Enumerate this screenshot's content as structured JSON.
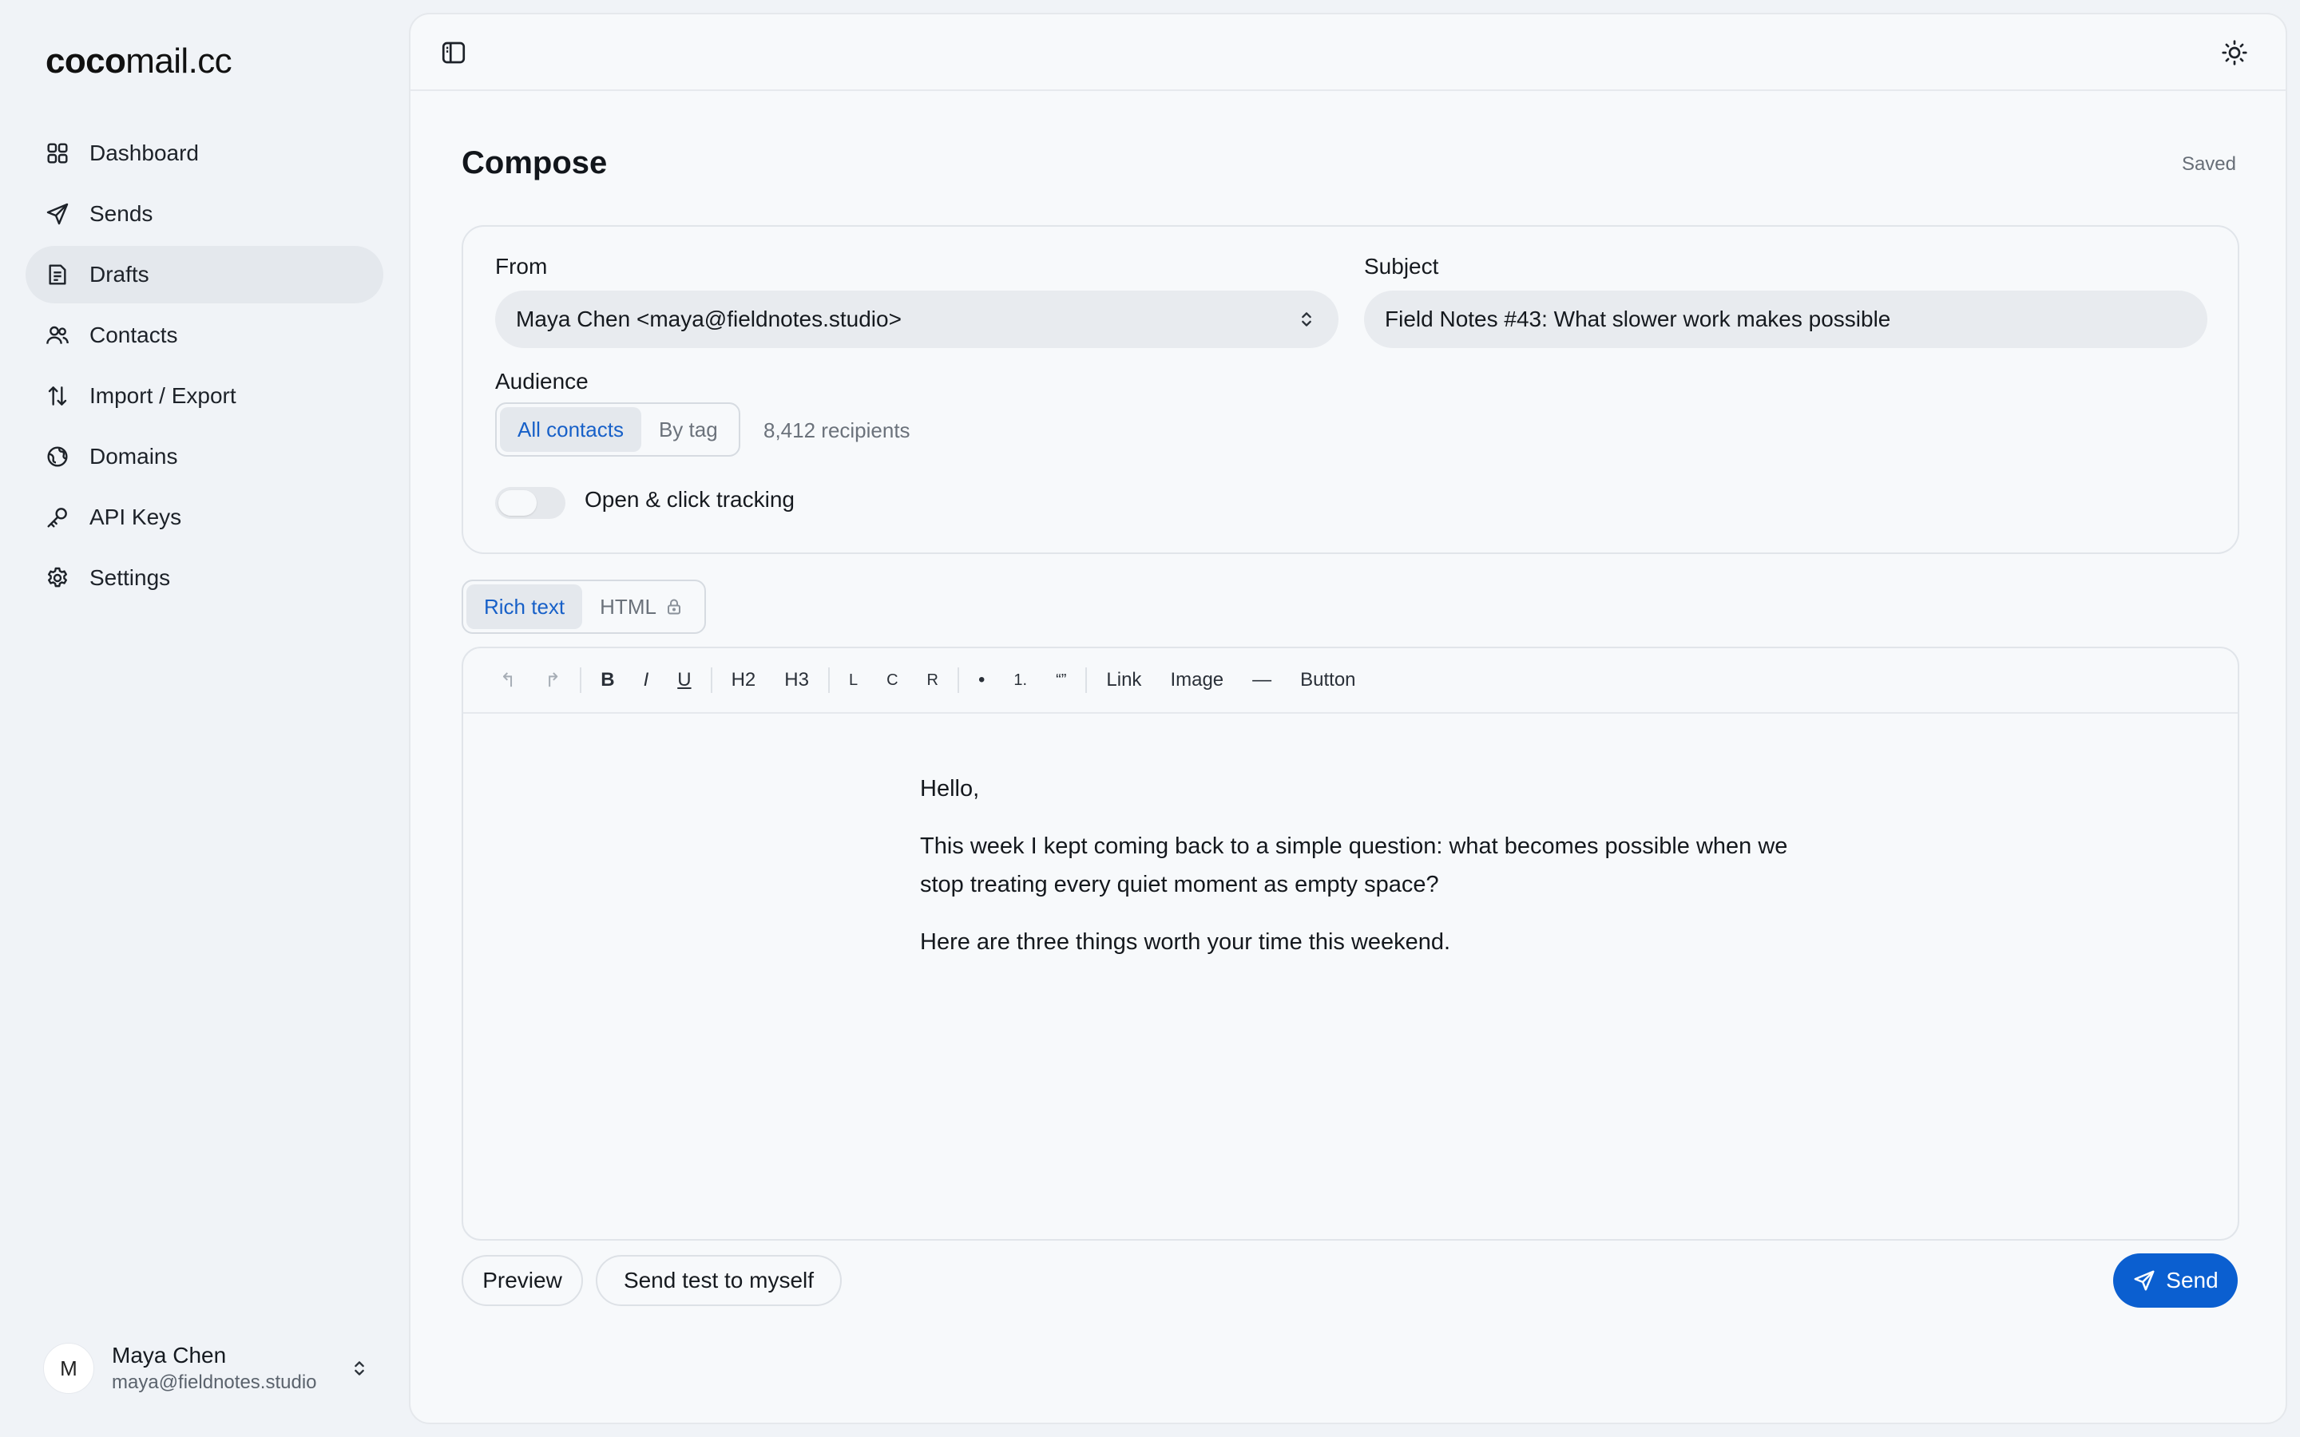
{
  "brand": {
    "bold": "coco",
    "rest": "mail.cc"
  },
  "nav": [
    {
      "label": "Dashboard",
      "icon": "dashboard-icon"
    },
    {
      "label": "Sends",
      "icon": "send-icon"
    },
    {
      "label": "Drafts",
      "icon": "draft-icon",
      "active": true
    },
    {
      "label": "Contacts",
      "icon": "contacts-icon"
    },
    {
      "label": "Import / Export",
      "icon": "import-export-icon"
    },
    {
      "label": "Domains",
      "icon": "globe-icon"
    },
    {
      "label": "API Keys",
      "icon": "key-icon"
    },
    {
      "label": "Settings",
      "icon": "gear-icon"
    }
  ],
  "user": {
    "initial": "M",
    "name": "Maya Chen",
    "email": "maya@fieldnotes.studio"
  },
  "page": {
    "title": "Compose",
    "status": "Saved"
  },
  "form": {
    "from_label": "From",
    "from_value": "Maya Chen <maya@fieldnotes.studio>",
    "subject_label": "Subject",
    "subject_value": "Field Notes #43: What slower work makes possible",
    "audience_label": "Audience",
    "audience_options": [
      "All contacts",
      "By tag"
    ],
    "audience_selected": "All contacts",
    "recipients": "8,412 recipients",
    "tracking_label": "Open & click tracking",
    "tracking_enabled": false
  },
  "editor_modes": {
    "rich": "Rich text",
    "html": "HTML",
    "selected": "Rich text"
  },
  "toolbar": {
    "undo": "↰",
    "redo": "↱",
    "bold": "B",
    "italic": "I",
    "underline": "U",
    "h2": "H2",
    "h3": "H3",
    "left": "L",
    "center": "C",
    "right": "R",
    "bullet": "•",
    "numbered": "1.",
    "quote": "“”",
    "link": "Link",
    "image": "Image",
    "divider": "—",
    "button": "Button"
  },
  "body": {
    "greeting": "Hello,",
    "paragraph1": "This week I kept coming back to a simple question: what becomes possible when we stop treating every quiet moment as empty space?",
    "paragraph2": "Here are three things worth your time this weekend."
  },
  "actions": {
    "preview": "Preview",
    "send_test": "Send test to myself",
    "send": "Send"
  },
  "colors": {
    "accent": "#0b5fd0",
    "active_nav": "#e4e8ed",
    "background": "#f0f3f7"
  }
}
